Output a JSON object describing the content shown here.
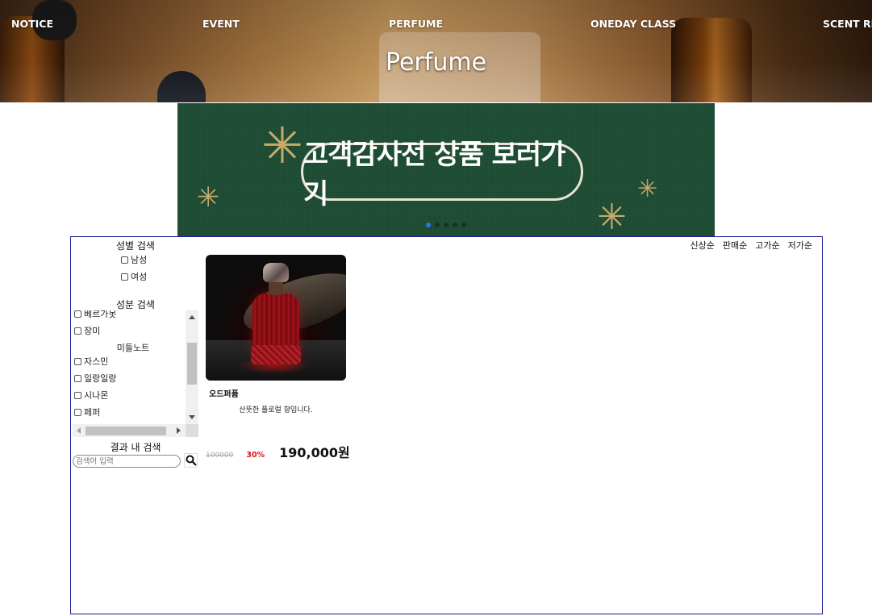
{
  "header": {
    "nav": [
      "NOTICE",
      "EVENT",
      "PERFUME",
      "ONEDAY CLASS",
      "SCENT RE"
    ],
    "title": "Perfume"
  },
  "banner": {
    "text": "고객감사전 상품 보러가기",
    "slide_count": 5,
    "active_slide": 1,
    "colors": {
      "background": "#1c4a33",
      "star": "#c8a96a",
      "active_dot": "#1e7de0"
    }
  },
  "sidebar": {
    "gender_title": "성별 검색",
    "gender_options": [
      "남성",
      "여성"
    ],
    "ingredient_title": "성분 검색",
    "ingredient_top_items": [
      "베르가못",
      "장미"
    ],
    "middle_note_label": "미들노트",
    "middle_note_items": [
      "자스민",
      "일랑일랑",
      "시나몬",
      "페퍼"
    ],
    "result_search_title": "결과 내 검색",
    "search_placeholder": "검색어 입력"
  },
  "sort": [
    "신상순",
    "판매순",
    "고가순",
    "저가순"
  ],
  "products": [
    {
      "name": "오드퍼퓸",
      "description": "산뜻한 플로럴 향입니다.",
      "original_price": "100000",
      "discount": "30%",
      "price": "190,000원"
    }
  ],
  "colors": {
    "content_border": "#1a1a9c",
    "discount": "#dd1111"
  }
}
